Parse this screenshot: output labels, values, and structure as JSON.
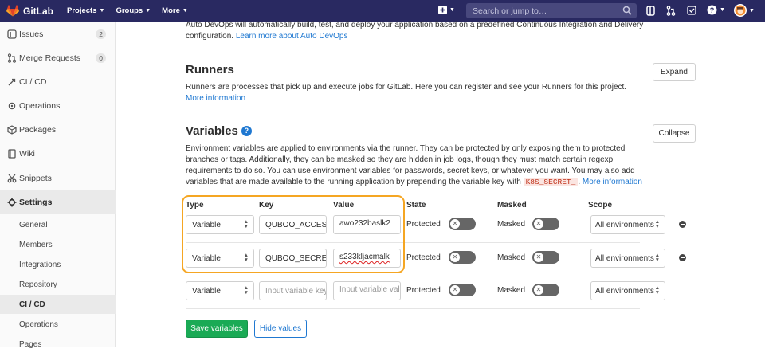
{
  "header": {
    "app_name": "GitLab",
    "nav": [
      "Projects",
      "Groups",
      "More"
    ],
    "search_placeholder": "Search or jump to…"
  },
  "sidebar": {
    "items": [
      {
        "label": "Issues",
        "count": "2"
      },
      {
        "label": "Merge Requests",
        "count": "0"
      },
      {
        "label": "CI / CD"
      },
      {
        "label": "Operations"
      },
      {
        "label": "Packages"
      },
      {
        "label": "Wiki"
      },
      {
        "label": "Snippets"
      },
      {
        "label": "Settings"
      }
    ],
    "subitems": [
      "General",
      "Members",
      "Integrations",
      "Repository",
      "CI / CD",
      "Operations",
      "Pages"
    ]
  },
  "autodevops": {
    "text": "Auto DevOps will automatically build, test, and deploy your application based on a predefined Continuous Integration and Delivery configuration.",
    "link": "Learn more about Auto DevOps"
  },
  "runners": {
    "title": "Runners",
    "description": "Runners are processes that pick up and execute jobs for GitLab. Here you can register and see your Runners for this project.",
    "link": "More information",
    "button": "Expand"
  },
  "variables": {
    "title": "Variables",
    "button": "Collapse",
    "description": "Environment variables are applied to environments via the runner. They can be protected by only exposing them to protected branches or tags. Additionally, they can be masked so they are hidden in job logs, though they must match certain regexp requirements to do so. You can use environment variables for passwords, secret keys, or whatever you want. You may also add variables that are made available to the running application by prepending the variable key with",
    "code": "K8S_SECRET_",
    "tail": ".",
    "link": "More information",
    "headers": {
      "type": "Type",
      "key": "Key",
      "value": "Value",
      "state": "State",
      "masked": "Masked",
      "scope": "Scope"
    },
    "rows": [
      {
        "type": "Variable",
        "key": "QUBOO_ACCESS_KEY",
        "value": "awo232baslk2",
        "state": "Protected",
        "masked": "Masked",
        "scope": "All environments"
      },
      {
        "type": "Variable",
        "key": "QUBOO_SECRET_KEY",
        "value": "s233kljacmalk",
        "state": "Protected",
        "masked": "Masked",
        "scope": "All environments"
      }
    ],
    "new_row": {
      "type": "Variable",
      "key_placeholder": "Input variable key",
      "value_placeholder": "Input variable value",
      "state": "Protected",
      "masked": "Masked",
      "scope": "All environments"
    },
    "save_button": "Save variables",
    "hide_button": "Hide values"
  }
}
